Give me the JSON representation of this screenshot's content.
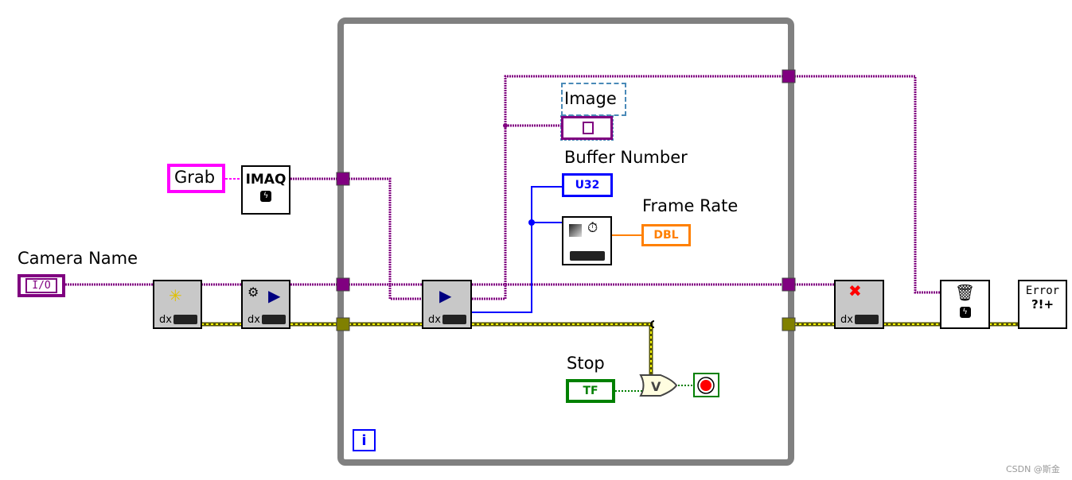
{
  "labels": {
    "grab": "Grab",
    "camera_name": "Camera Name",
    "image": "Image",
    "buffer_number": "Buffer Number",
    "frame_rate": "Frame Rate",
    "stop": "Stop"
  },
  "terminals": {
    "camera_name_type": "I/O",
    "buffer_number_type": "U32",
    "frame_rate_type": "DBL",
    "stop_type": "TF",
    "imaq_text": "IMAQ",
    "error_text": "Error",
    "error_symbols": "?!+",
    "loop_iteration": "i",
    "or_gate": "V",
    "dx": "dx"
  },
  "watermark": "CSDN @斯金",
  "colors": {
    "session_wire": "#800080",
    "string_wire": "#ff00ff",
    "error_wire": "#d8d800",
    "numeric_u32": "#0000ff",
    "numeric_dbl": "#ff8000",
    "boolean": "#008000",
    "loop_border": "#808080"
  }
}
